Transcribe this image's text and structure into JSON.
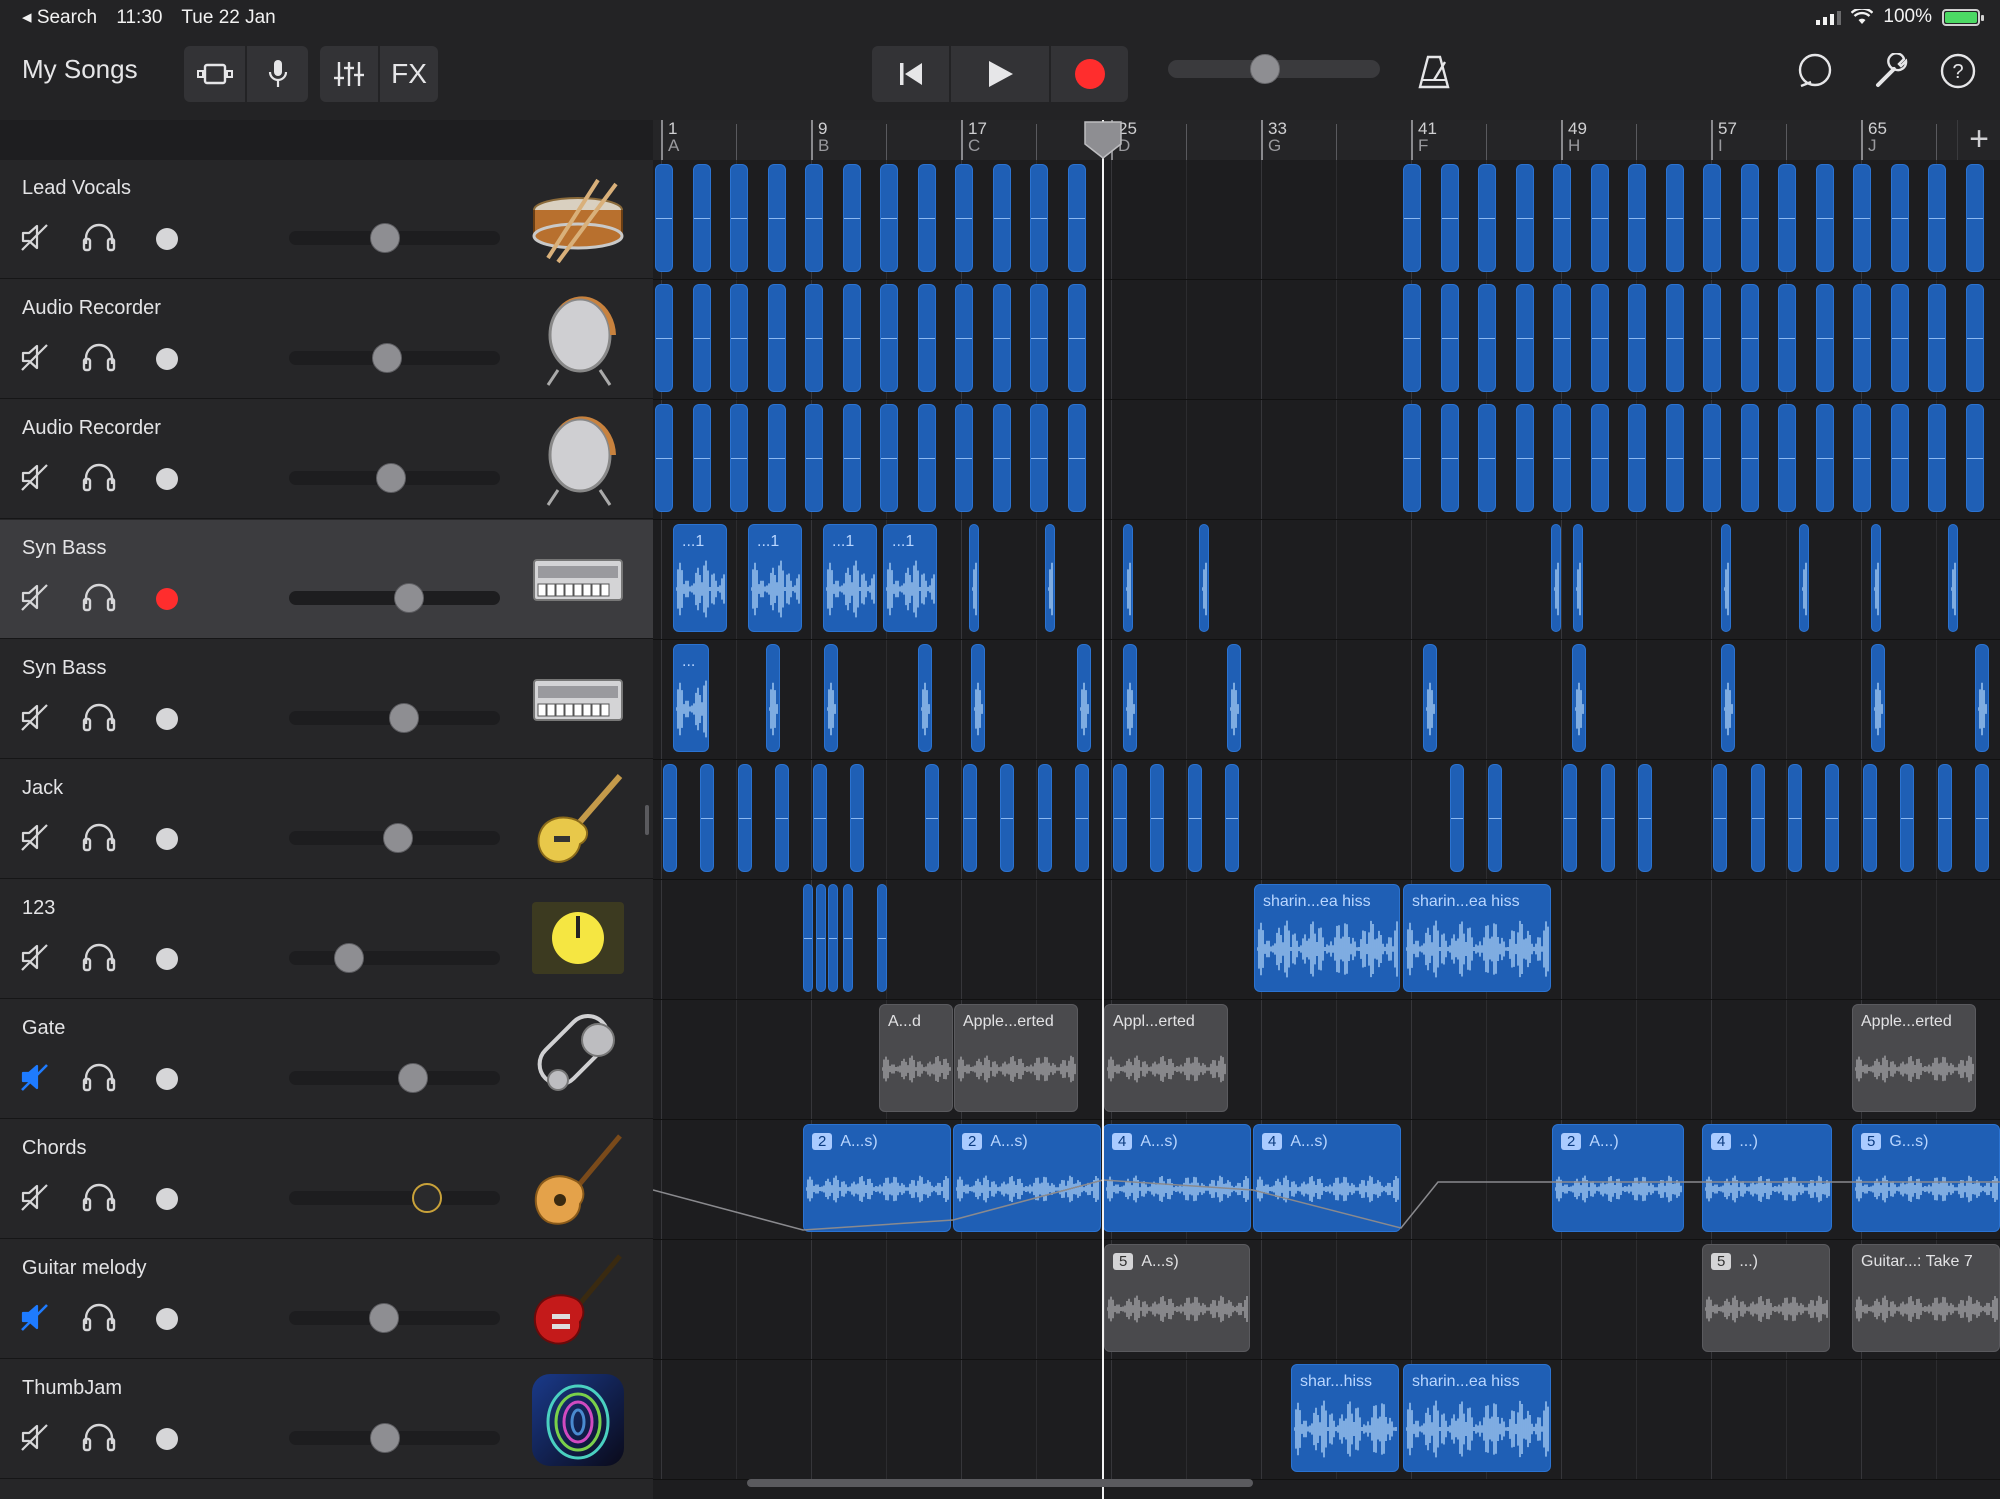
{
  "status": {
    "back_app": "◂ Search",
    "time": "11:30",
    "date": "Tue 22 Jan",
    "battery_pct": "100%",
    "battery_level": 1.0
  },
  "toolbar": {
    "my_songs": "My Songs",
    "fx_label": "FX",
    "icons": [
      "browser-icon",
      "microphone-icon",
      "mixer-icon",
      "fx-label",
      "rewind-icon",
      "play-icon",
      "record-icon",
      "metronome-icon",
      "loop-icon",
      "wrench-icon",
      "help-icon"
    ],
    "master_volume": 0.45,
    "record_color": "#ff2d2d"
  },
  "ruler": {
    "bars": [
      {
        "num": "1",
        "sec": "A"
      },
      {
        "num": "9",
        "sec": "B"
      },
      {
        "num": "17",
        "sec": "C"
      },
      {
        "num": "25",
        "sec": "D"
      },
      {
        "num": "33",
        "sec": "G"
      },
      {
        "num": "41",
        "sec": "F"
      },
      {
        "num": "49",
        "sec": "H"
      },
      {
        "num": "57",
        "sec": "I"
      },
      {
        "num": "65",
        "sec": "J"
      }
    ],
    "add_label": "+"
  },
  "tracks": [
    {
      "name": "Lead Vocals",
      "volume": 0.45,
      "mute": false,
      "armed": false,
      "selected": false,
      "instrument": "snare-drum-icon"
    },
    {
      "name": "Audio Recorder",
      "volume": 0.46,
      "mute": false,
      "armed": false,
      "selected": false,
      "instrument": "drum-icon"
    },
    {
      "name": "Audio Recorder",
      "volume": 0.48,
      "mute": false,
      "armed": false,
      "selected": false,
      "instrument": "drum-icon"
    },
    {
      "name": "Syn Bass",
      "volume": 0.58,
      "mute": false,
      "armed": true,
      "selected": true,
      "instrument": "synth-icon"
    },
    {
      "name": "Syn Bass",
      "volume": 0.55,
      "mute": false,
      "armed": false,
      "selected": false,
      "instrument": "synth-icon"
    },
    {
      "name": "Jack",
      "volume": 0.52,
      "mute": false,
      "armed": false,
      "selected": false,
      "instrument": "electric-guitar-icon"
    },
    {
      "name": "123",
      "volume": 0.25,
      "mute": false,
      "armed": false,
      "selected": false,
      "instrument": "knob-icon"
    },
    {
      "name": "Gate",
      "volume": 0.6,
      "mute": true,
      "armed": false,
      "selected": false,
      "instrument": "gear-icon"
    },
    {
      "name": "Chords",
      "volume": 0.68,
      "mute": false,
      "armed": false,
      "selected": false,
      "instrument": "acoustic-guitar-icon"
    },
    {
      "name": "Guitar melody",
      "volume": 0.44,
      "mute": true,
      "armed": false,
      "selected": false,
      "instrument": "red-guitar-icon"
    },
    {
      "name": "ThumbJam",
      "volume": 0.45,
      "mute": false,
      "armed": false,
      "selected": false,
      "instrument": "thumbjam-icon"
    }
  ],
  "regions": {
    "lane6": [
      {
        "label": "sharin...ea hiss"
      },
      {
        "label": "sharin...ea hiss"
      }
    ],
    "lane7": [
      {
        "label": "A...d"
      },
      {
        "label": "Apple...erted"
      },
      {
        "label": "Appl...erted"
      },
      {
        "label": "Apple...erted"
      }
    ],
    "lane8": [
      {
        "num": "2",
        "label": "A...s)"
      },
      {
        "num": "2",
        "label": "A...s)"
      },
      {
        "num": "4",
        "label": "A...s)"
      },
      {
        "num": "4",
        "label": "A...s)"
      },
      {
        "num": "2",
        "label": "A...)"
      },
      {
        "num": "4",
        "label": "...)"
      },
      {
        "num": "5",
        "label": "G...s)"
      }
    ],
    "lane9": [
      {
        "num": "5",
        "label": "A...s)"
      },
      {
        "num": "5",
        "label": "...)"
      },
      {
        "label": "Guitar...: Take 7"
      }
    ],
    "lane10": [
      {
        "label": "shar...hiss"
      },
      {
        "label": "sharin...ea hiss"
      }
    ],
    "lane3_labels": [
      "...1",
      "...1",
      "...1",
      "...1"
    ],
    "lane4_labels": [
      "..."
    ]
  },
  "colors": {
    "region_blue": "#1f5fb5",
    "region_gray": "#4a4a4d",
    "mute_active": "#1e7bff",
    "armed": "#ff2d2d"
  }
}
